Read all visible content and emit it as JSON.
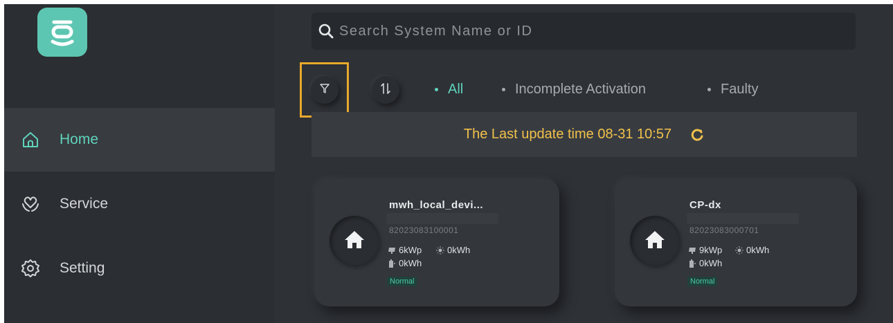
{
  "colors": {
    "accent": "#5fd3bb",
    "logo_bg": "#5dc6b2",
    "highlight": "#e8a82c",
    "update_text": "#f2c14b",
    "background": "#2e3136",
    "sidebar_bg": "#2b2e32"
  },
  "sidebar": {
    "logo_icon": "app-logo-icon",
    "items": [
      {
        "label": "Home",
        "icon": "home-outline-icon",
        "active": true
      },
      {
        "label": "Service",
        "icon": "heart-hands-icon",
        "active": false
      },
      {
        "label": "Setting",
        "icon": "gear-icon",
        "active": false
      }
    ]
  },
  "search": {
    "placeholder": "Search System Name or ID",
    "icon": "search-icon"
  },
  "toolbar": {
    "filter_icon": "filter-icon",
    "sort_icon": "sort-icon"
  },
  "tabs": [
    {
      "label": "All",
      "active": true
    },
    {
      "label": "Incomplete Activation",
      "active": false
    },
    {
      "label": "Faulty",
      "active": false
    }
  ],
  "update": {
    "text": "The Last update time 08-31 10:57",
    "icon": "refresh-icon"
  },
  "systems": [
    {
      "name": "mwh_local_devi...",
      "id": "82023083100001",
      "pv_power": "6kWp",
      "energy": "0kWh",
      "storage": "0kWh",
      "status": "Normal"
    },
    {
      "name": "CP-dx",
      "id": "82023083000701",
      "pv_power": "9kWp",
      "energy": "0kWh",
      "storage": "0kWh",
      "status": "Normal"
    }
  ]
}
